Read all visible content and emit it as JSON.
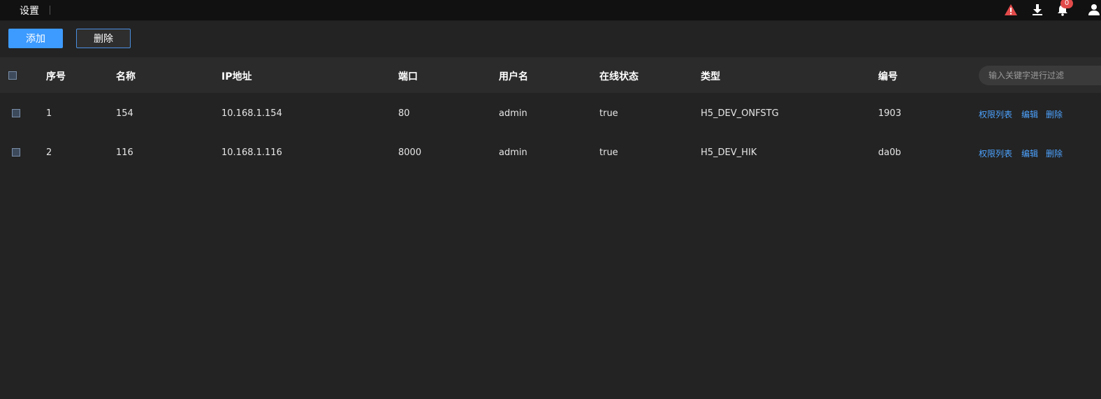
{
  "topbar": {
    "title": "设置",
    "notification_count": "0",
    "icons": [
      "alert-triangle-icon",
      "download-icon",
      "bell-icon",
      "user-icon"
    ],
    "colors": {
      "alert": "#e24a4a",
      "badge": "#e24a4a"
    }
  },
  "toolbar": {
    "add_label": "添加",
    "delete_label": "删除",
    "colors": {
      "primary": "#3d9bff"
    }
  },
  "table": {
    "headers": [
      "序号",
      "名称",
      "IP地址",
      "端口",
      "用户名",
      "在线状态",
      "类型",
      "编号"
    ],
    "search_placeholder": "输入关键字进行过滤",
    "rows": [
      {
        "index": "1",
        "name": "154",
        "ip": "10.168.1.154",
        "port": "80",
        "username": "admin",
        "online": "true",
        "type": "H5_DEV_ONFSTG",
        "code": "1903",
        "actions": [
          "权限列表",
          "编辑",
          "删除"
        ]
      },
      {
        "index": "2",
        "name": "116",
        "ip": "10.168.1.116",
        "port": "8000",
        "username": "admin",
        "online": "true",
        "type": "H5_DEV_HIK",
        "code": "da0b",
        "actions": [
          "权限列表",
          "编辑",
          "删除"
        ]
      }
    ],
    "colors": {
      "link": "#4da3ff"
    }
  }
}
